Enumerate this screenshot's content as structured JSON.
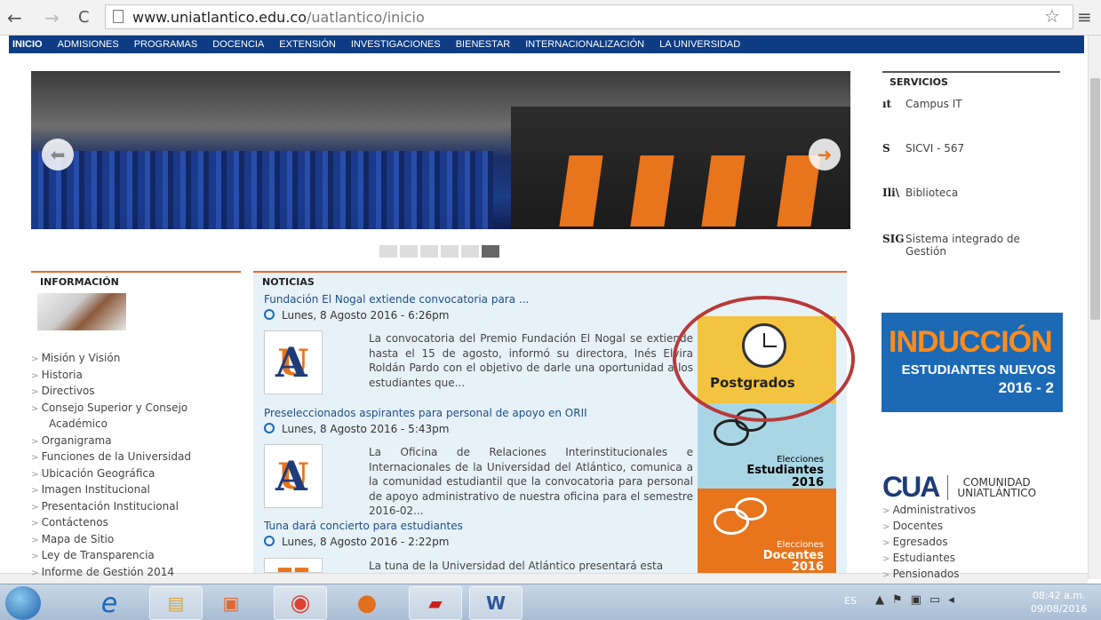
{
  "browser": {
    "url_host": "www.uniatlantico.edu.co",
    "url_path": "/uatlantico/inicio"
  },
  "topnav": [
    "INICIO",
    "ADMISIONES",
    "PROGRAMAS",
    "DOCENCIA",
    "EXTENSIÓN",
    "INVESTIGACIONES",
    "BIENESTAR",
    "INTERNACIONALIZACIÓN",
    "LA UNIVERSIDAD"
  ],
  "services": {
    "title": "SERVICIOS",
    "items": [
      {
        "icon": "ıt",
        "label": "Campus IT"
      },
      {
        "icon": "S",
        "label": "SICVI - 567"
      },
      {
        "icon": "Ili\\",
        "label": "Biblioteca"
      },
      {
        "icon": "SIG",
        "label": "Sistema integrado de Gestión"
      }
    ]
  },
  "banner": {
    "line1": "INDUCCIÓN",
    "line2": "ESTUDIANTES NUEVOS",
    "line3": "2016 - 2"
  },
  "comunidad": {
    "mark": "CUA",
    "text1": "COMUNIDAD",
    "text2": "UNIATLÁNTICO",
    "items": [
      "Administrativos",
      "Docentes",
      "Egresados",
      "Estudiantes",
      "Pensionados"
    ]
  },
  "info": {
    "title": "INFORMACIÓN",
    "items": [
      "Misión y Visión",
      "Historia",
      "Directivos",
      "Consejo Superior y Consejo",
      "Académico",
      "Organigrama",
      "Funciones de la Universidad",
      "Ubicación Geográfica",
      "Imagen Institucional",
      "Presentación Institucional",
      "Contáctenos",
      "Mapa de Sitio",
      "Ley de Transparencia",
      "Informe de Gestión 2014"
    ]
  },
  "news": {
    "title": "NOTICIAS",
    "items": [
      {
        "title": "Fundación El Nogal extiende convocatoria para ...",
        "date": "Lunes, 8 Agosto 2016 - 6:26pm",
        "body": "La convocatoria del Premio Fundación El Nogal se extiende hasta el 15 de agosto, informó su directora, Inés Elvira Roldán Pardo con el objetivo de darle una oportunidad a los estudiantes que..."
      },
      {
        "title": "Preseleccionados aspirantes para personal de apoyo en ORII",
        "date": "Lunes, 8 Agosto 2016 - 5:43pm",
        "body": "La Oficina de Relaciones Interinstitucionales e Internacionales de la Universidad del Atlántico, comunica a la comunidad estudiantil que la convocatoria para personal de apoyo administrativo de nuestra oficina para el semestre 2016-02..."
      },
      {
        "title": "Tuna dará concierto para estudiantes",
        "date": "Lunes, 8 Agosto 2016 - 2:22pm",
        "body": "La tuna de la Universidad del Atlántico presentará esta"
      }
    ]
  },
  "tiles": {
    "postgrados": "Postgrados",
    "est1": "Elecciones",
    "est2": "Estudiantes",
    "est3": "2016",
    "doc1": "Elecciones",
    "doc2": "Docentes",
    "doc3": "2016"
  },
  "taskbar": {
    "lang": "ES",
    "time": "08:42 a.m.",
    "date": "09/08/2016"
  },
  "colors": {
    "nav": "#0d3c84",
    "accent": "#e8741c",
    "link": "#1d4f8c"
  }
}
